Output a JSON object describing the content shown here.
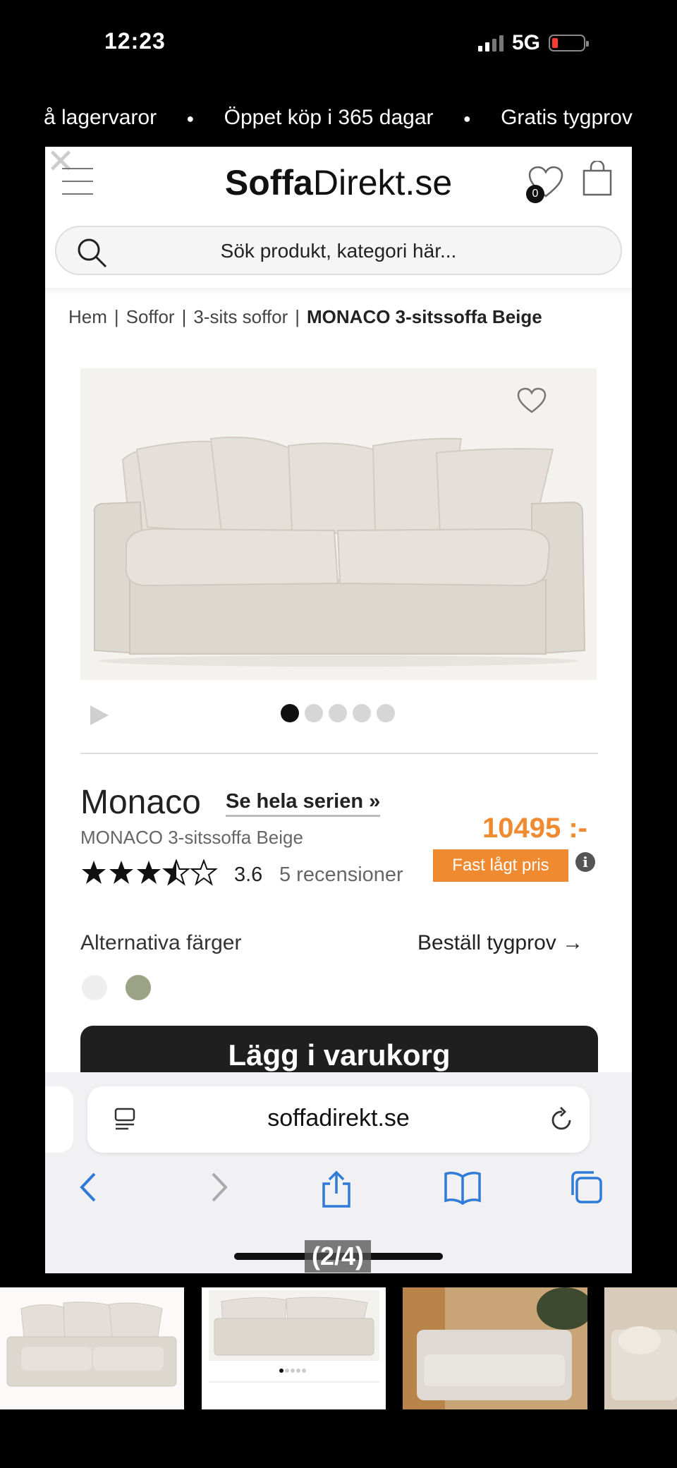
{
  "status_bar": {
    "time": "12:23",
    "network": "5G"
  },
  "ticker": [
    "å lagervaror",
    "●",
    "Öppet köp i 365 dagar",
    "●",
    "Gratis tygprov"
  ],
  "header": {
    "logo_bold": "Soffa",
    "logo_regular": "Direkt.se",
    "wishlist_count": "0",
    "search_placeholder": "Sök produkt, kategori här..."
  },
  "breadcrumb": {
    "items": [
      "Hem",
      "Soffor",
      "3-sits soffor"
    ],
    "current": "MONACO 3-sitssoffa Beige",
    "separator": "|"
  },
  "gallery": {
    "slide_count": 5,
    "active_slide": 1
  },
  "product": {
    "name": "Monaco",
    "series_link": "Se hela serien »",
    "subtitle": "MONACO 3-sitssoffa Beige",
    "price": "10495 :-",
    "price_badge": "Fast lågt pris",
    "rating": "3.6",
    "rating_value": 3.6,
    "reviews": "5 recensioner",
    "alt_colors_label": "Alternativa färger",
    "order_sample": "Beställ tygprov →",
    "swatches": [
      "#eeeeee",
      "#9ca286"
    ],
    "add_to_cart": "Lägg i varukorg"
  },
  "browser": {
    "url": "soffadirekt.se"
  },
  "viewer": {
    "counter": "(2/4)"
  },
  "colors": {
    "accent": "#f08a30",
    "button": "#1f1f1f",
    "ios_blue": "#2f7bd8"
  }
}
